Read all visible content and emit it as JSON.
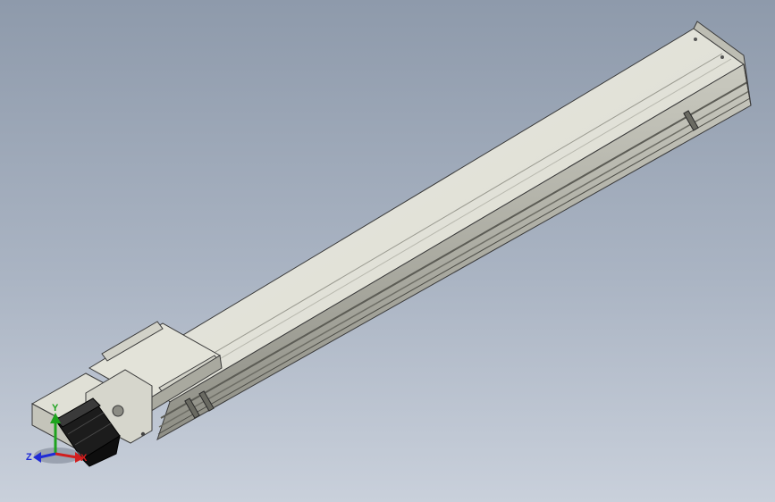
{
  "viewport": {
    "type": "cad-3d-view",
    "background_top": "#8e9aab",
    "background_bottom": "#c9d0db"
  },
  "model": {
    "part": "linear-module",
    "body_color": "#dcdcd2",
    "edge_color": "#3a3a3a",
    "motor_color": "#1c1c1c"
  },
  "triad": {
    "axes": [
      {
        "label": "Z",
        "color": "#1f2bd6"
      },
      {
        "label": "Y",
        "color": "#1ea31e"
      },
      {
        "label": "X",
        "color": "#d21e1e"
      }
    ]
  }
}
